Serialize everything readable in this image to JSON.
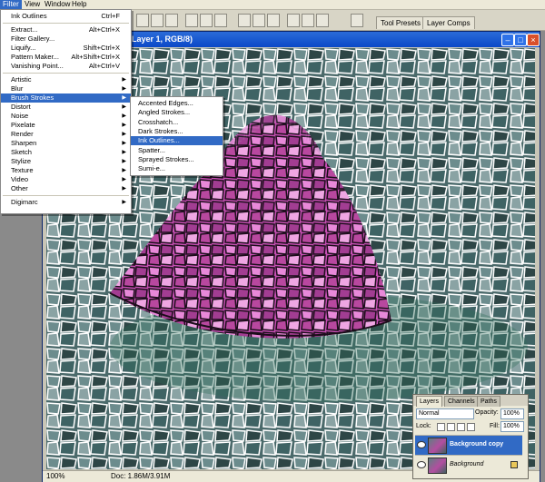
{
  "menubar": {
    "items": [
      {
        "label": "Filter",
        "active": true
      },
      {
        "label": "View"
      },
      {
        "label": "Window"
      },
      {
        "label": "Help"
      }
    ]
  },
  "palette_well_tabs": [
    "Tool Presets",
    "Layer Comps"
  ],
  "document": {
    "title": "Layer 1, RGB/8)",
    "zoom": "100%",
    "doc_size": "Doc: 1.86M/3.91M"
  },
  "filter_menu": {
    "items": [
      {
        "label": "Ink Outlines",
        "shortcut": "Ctrl+F"
      },
      {
        "sep": true
      },
      {
        "label": "Extract...",
        "shortcut": "Alt+Ctrl+X"
      },
      {
        "label": "Filter Gallery..."
      },
      {
        "label": "Liquify...",
        "shortcut": "Shift+Ctrl+X"
      },
      {
        "label": "Pattern Maker...",
        "shortcut": "Alt+Shift+Ctrl+X"
      },
      {
        "label": "Vanishing Point...",
        "shortcut": "Alt+Ctrl+V"
      },
      {
        "sep": true
      },
      {
        "label": "Artistic",
        "sub": true
      },
      {
        "label": "Blur",
        "sub": true
      },
      {
        "label": "Brush Strokes",
        "sub": true,
        "active": true
      },
      {
        "label": "Distort",
        "sub": true
      },
      {
        "label": "Noise",
        "sub": true
      },
      {
        "label": "Pixelate",
        "sub": true
      },
      {
        "label": "Render",
        "sub": true
      },
      {
        "label": "Sharpen",
        "sub": true
      },
      {
        "label": "Sketch",
        "sub": true
      },
      {
        "label": "Stylize",
        "sub": true
      },
      {
        "label": "Texture",
        "sub": true
      },
      {
        "label": "Video",
        "sub": true
      },
      {
        "label": "Other",
        "sub": true
      },
      {
        "sep": true
      },
      {
        "label": "Digimarc",
        "sub": true
      }
    ]
  },
  "brush_strokes_submenu": {
    "items": [
      {
        "label": "Accented Edges..."
      },
      {
        "label": "Angled Strokes..."
      },
      {
        "label": "Crosshatch..."
      },
      {
        "label": "Dark Strokes..."
      },
      {
        "label": "Ink Outlines...",
        "active": true
      },
      {
        "label": "Spatter..."
      },
      {
        "label": "Sprayed Strokes..."
      },
      {
        "label": "Sumi-e..."
      }
    ]
  },
  "layers_panel": {
    "tabs": [
      {
        "label": "Layers",
        "active": true
      },
      {
        "label": "Channels"
      },
      {
        "label": "Paths"
      }
    ],
    "blend_mode": "Normal",
    "opacity_label": "Opacity:",
    "opacity": "100%",
    "lock_label": "Lock:",
    "fill_label": "Fill:",
    "fill": "100%",
    "layers": [
      {
        "name": "Background copy",
        "selected": true
      },
      {
        "name": "Background",
        "locked": true
      }
    ]
  },
  "colors": {
    "menu_highlight": "#316ac5",
    "title_bar": "#0a48c8"
  }
}
